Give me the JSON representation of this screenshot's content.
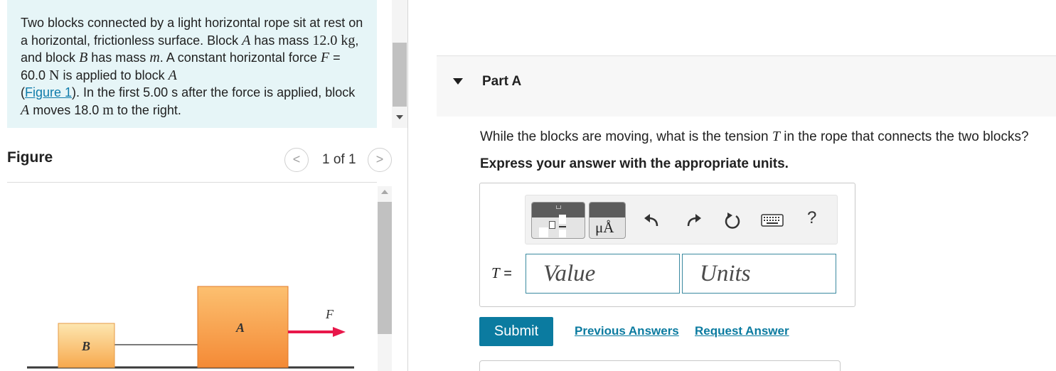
{
  "problem": {
    "t1": "Two blocks connected by a light horizontal rope sit at rest on a horizontal, frictionless surface. Block ",
    "block_a": "A",
    "t2": " has mass ",
    "mass_a": "12.0 kg",
    "t3": ", and block ",
    "block_b": "B",
    "t4": " has mass ",
    "mass_b": "m",
    "t5": ". A constant horizontal force ",
    "force_sym": "F",
    "t6": " = 60.0 ",
    "force_unit": "N",
    "t7": " is applied to block ",
    "block_a2": "A",
    "t8": " (",
    "figure_link": "Figure 1",
    "t9": "). In the first 5.00 s after the force is applied, block ",
    "block_a3": "A",
    "t10": " moves 18.0 ",
    "dist_unit": "m",
    "t11": " to the right."
  },
  "figure": {
    "title": "Figure",
    "prev": "<",
    "next": ">",
    "counter": "1 of 1",
    "label_a": "A",
    "label_b": "B",
    "label_f": "F",
    "colors": {
      "block_fill": "#f7a14a",
      "block_light": "#fcd38c",
      "arrow": "#e8174a"
    }
  },
  "part": {
    "label": "Part A"
  },
  "question": {
    "text1": "While the blocks are moving, what is the tension ",
    "var": "T",
    "text2": " in the rope that connects the two blocks?",
    "instruction": "Express your answer with the appropriate units."
  },
  "toolbar": {
    "units_glyph": "μÅ",
    "help": "?"
  },
  "answer": {
    "var": "T",
    "equals": " =",
    "value_placeholder": "Value",
    "units_placeholder": "Units"
  },
  "actions": {
    "submit": "Submit",
    "previous_answers": "Previous Answers",
    "request_answer": "Request Answer"
  },
  "colors": {
    "accent": "#0b7ba0",
    "problem_bg": "#e6f5f7"
  }
}
